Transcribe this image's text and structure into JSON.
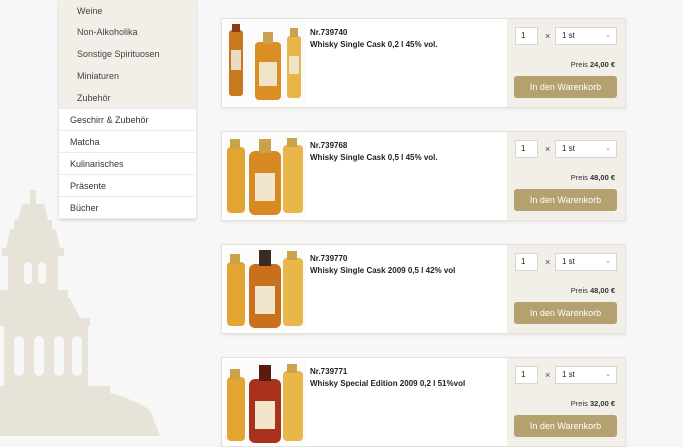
{
  "sidebar": {
    "items": [
      {
        "label": "Weine",
        "sub": true
      },
      {
        "label": "Non-Alkoholika",
        "sub": true
      },
      {
        "label": "Sonstige Spirituosen",
        "sub": true
      },
      {
        "label": "Miniaturen",
        "sub": true
      },
      {
        "label": "Zubehör",
        "sub": true
      },
      {
        "label": "Geschirr & Zubehör",
        "sub": false
      },
      {
        "label": "Matcha",
        "sub": false
      },
      {
        "label": "Kulinarisches",
        "sub": false
      },
      {
        "label": "Präsente",
        "sub": false
      },
      {
        "label": "Bücher",
        "sub": false
      }
    ]
  },
  "products": [
    {
      "nr": "Nr.739740",
      "name": "Whisky Single Cask 0,2 l 45% vol.",
      "qty": "1",
      "unit": "1 st",
      "price_label": "Preis",
      "price": "24,00 €",
      "cart_label": "In den Warenkorb"
    },
    {
      "nr": "Nr.739768",
      "name": "Whisky Single Cask 0,5 l 45% vol.",
      "qty": "1",
      "unit": "1 st",
      "price_label": "Preis",
      "price": "48,00 €",
      "cart_label": "In den Warenkorb"
    },
    {
      "nr": "Nr.739770",
      "name": "Whisky Single Cask 2009 0,5 l 42% vol",
      "qty": "1",
      "unit": "1 st",
      "price_label": "Preis",
      "price": "48,00 €",
      "cart_label": "In den Warenkorb"
    },
    {
      "nr": "Nr.739771",
      "name": "Whisky Special Edition 2009 0,2 l 51%vol",
      "qty": "1",
      "unit": "1 st",
      "price_label": "Preis",
      "price": "32,00 €",
      "cart_label": "In den Warenkorb"
    }
  ],
  "colors": {
    "accent": "#b5a070",
    "buybox_bg": "#f1efe7",
    "sidebar_sub_bg": "#f1efe7"
  }
}
